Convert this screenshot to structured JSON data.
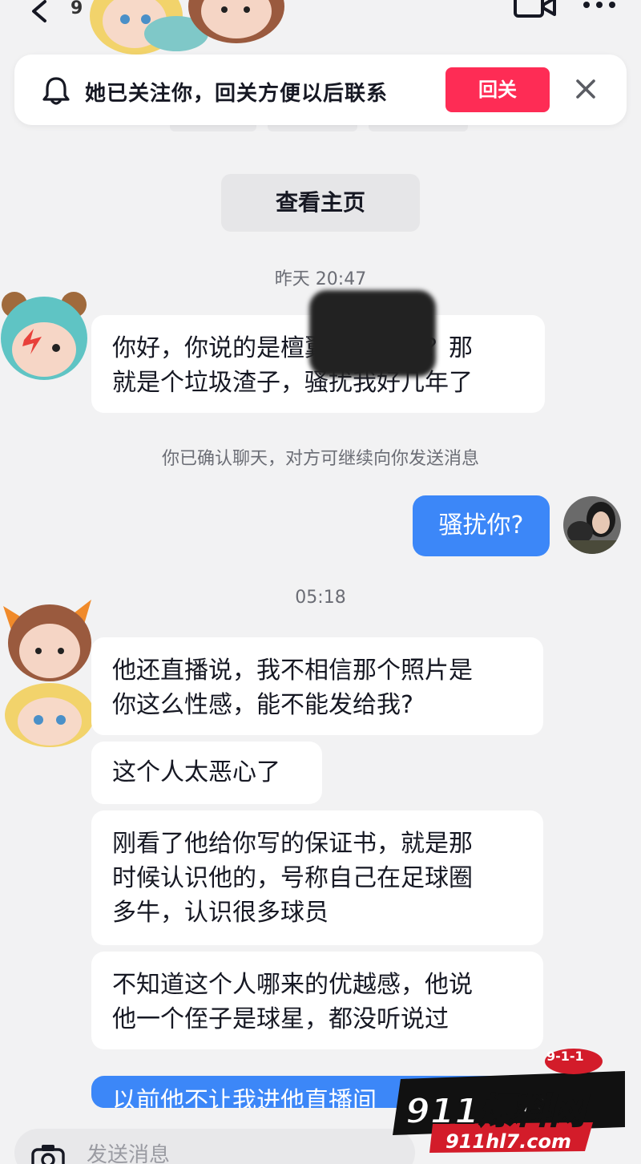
{
  "header": {
    "partial_count": "9",
    "back_icon": "chevron-left-icon",
    "video_icon": "video-call-icon",
    "more_icon": "more-dots-icon"
  },
  "banner": {
    "text": "她已关注你，回关方便以后联系",
    "follow_back_label": "回关",
    "accent": "#fe2c55"
  },
  "profile_button": "查看主页",
  "messages": {
    "time1": "昨天 20:47",
    "msg1_line1": "你好，你说的是檀翼张振兴吗？那",
    "msg1_line2": "就是个垃圾渣子，骚扰我好几年了",
    "system_notice": "你已确认聊天，对方可继续向你发送消息",
    "out1": "骚扰你?",
    "time2": "05:18",
    "msg2_line1": "他还直播说，我不相信那个照片是",
    "msg2_line2": "你这么性感，能不能发给我?",
    "msg3": "这个人太恶心了",
    "msg4_line1": "刚看了他给你写的保证书，就是那",
    "msg4_line2": "时候认识他的，号称自己在足球圈",
    "msg4_line3": "多牛，认识很多球员",
    "msg5_line1": "不知道这个人哪来的优越感，他说",
    "msg5_line2": "他一个侄子是球星，都没听说过",
    "out2_partial": "以前他不让我进他直播间"
  },
  "input": {
    "placeholder": "发送消息"
  },
  "watermark": {
    "brand": "911爆料网",
    "url": "911hl7.com",
    "badge": "9-1-1"
  },
  "colors": {
    "outgoing_bubble": "#3c87f8",
    "background": "#f2f2f3",
    "incoming_bubble": "#ffffff"
  }
}
